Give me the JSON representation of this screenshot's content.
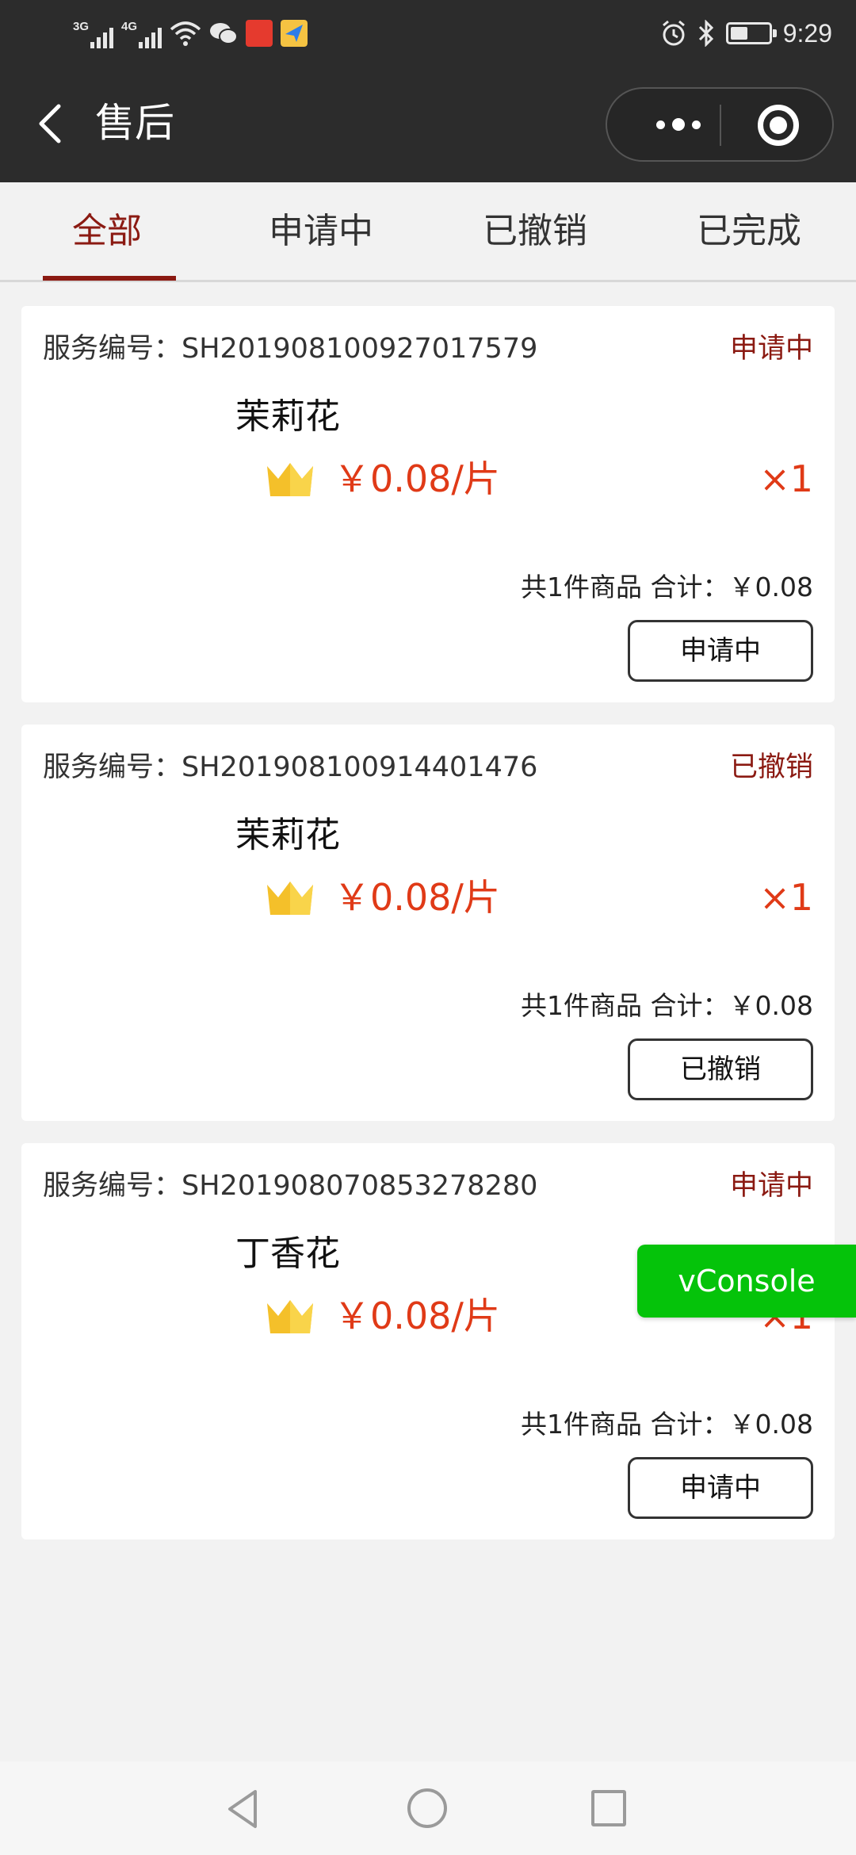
{
  "status_bar": {
    "signal_1_label": "3G",
    "signal_2_label": "4G",
    "time": "9:29",
    "battery_level": 0.45
  },
  "nav": {
    "title": "售后"
  },
  "tabs": [
    {
      "label": "全部",
      "active": true
    },
    {
      "label": "申请中",
      "active": false
    },
    {
      "label": "已撤销",
      "active": false
    },
    {
      "label": "已完成",
      "active": false
    }
  ],
  "orders": [
    {
      "service_label": "服务编号：",
      "service_no": "SH201908100927017579",
      "status": "申请中",
      "product_name": "茉莉花",
      "price": "￥0.08/片",
      "qty": "×1",
      "summary": "共1件商品 合计：￥0.08",
      "button": "申请中"
    },
    {
      "service_label": "服务编号：",
      "service_no": "SH201908100914401476",
      "status": "已撤销",
      "product_name": "茉莉花",
      "price": "￥0.08/片",
      "qty": "×1",
      "summary": "共1件商品 合计：￥0.08",
      "button": "已撤销"
    },
    {
      "service_label": "服务编号：",
      "service_no": "SH201908070853278280",
      "status": "申请中",
      "product_name": "丁香花",
      "price": "￥0.08/片",
      "qty": "×1",
      "summary": "共1件商品 合计：￥0.08",
      "button": "申请中"
    }
  ],
  "vconsole": "vConsole",
  "colors": {
    "accent": "#8b1a12",
    "price": "#e03a17",
    "vconsole": "#05c30a",
    "header_bg": "#2c2c2c"
  }
}
